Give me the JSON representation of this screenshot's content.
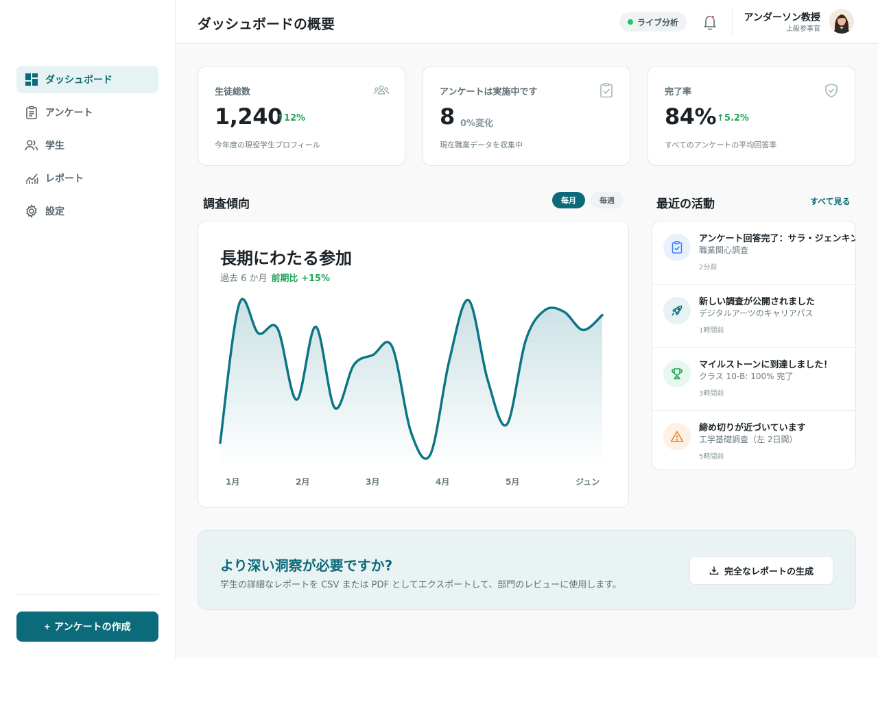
{
  "sidebar": {
    "items": [
      {
        "label": "ダッシュボード",
        "icon": "dashboard-icon",
        "active": true
      },
      {
        "label": "アンケート",
        "icon": "clipboard-icon",
        "active": false
      },
      {
        "label": "学生",
        "icon": "users-icon",
        "active": false
      },
      {
        "label": "レポート",
        "icon": "analytics-icon",
        "active": false
      },
      {
        "label": "設定",
        "icon": "gear-icon",
        "active": false
      }
    ],
    "create_button": "アンケートの作成"
  },
  "header": {
    "title": "ダッシュボードの概要",
    "live_label": "ライブ分析",
    "user_name": "アンダーソン教授",
    "user_role": "上級参事官"
  },
  "kpis": [
    {
      "label": "生徒総数",
      "value": "1,240",
      "change": "12%",
      "change_direction": "up",
      "subtitle": "今年度の現役学生プロフィール",
      "icon": "group-icon"
    },
    {
      "label": "アンケートは実施中です",
      "value": "8",
      "change": "0%変化",
      "change_direction": "none",
      "subtitle": "現在職業データを収集中",
      "icon": "checked-clipboard-icon"
    },
    {
      "label": "完了率",
      "value": "84%",
      "change": "5.2%",
      "change_direction": "up",
      "subtitle": "すべてのアンケートの平均回答率",
      "icon": "shield-check-icon"
    }
  ],
  "trends": {
    "section_title": "調査傾向",
    "toggle_monthly": "毎月",
    "toggle_weekly": "毎週",
    "selected": "monthly"
  },
  "chart_data": {
    "type": "area",
    "title": "長期にわたる参加",
    "subtitle": "過去 6 か月",
    "growth_label": "前期比 +15%",
    "x_ticks": [
      "1月",
      "2月",
      "3月",
      "4月",
      "5月",
      "ジュン"
    ],
    "x": [
      0,
      0.25,
      0.5,
      0.75,
      1,
      1.25,
      1.5,
      1.75,
      2,
      2.25,
      2.5,
      2.75,
      3,
      3.25,
      3.5,
      3.75,
      4,
      4.25,
      4.5,
      4.75,
      5
    ],
    "values": [
      0.12,
      0.96,
      0.78,
      0.81,
      0.38,
      0.82,
      0.33,
      0.59,
      0.65,
      0.7,
      0.18,
      0.05,
      0.62,
      0.98,
      0.5,
      0.23,
      0.74,
      0.92,
      0.91,
      0.8,
      0.89
    ],
    "ylim": [
      0,
      1
    ],
    "color": "#0c7584"
  },
  "activity": {
    "section_title": "最近の活動",
    "view_all": "すべて見る",
    "items": [
      {
        "title": "アンケート回答完了：サラ・ジェンキンス",
        "subtitle": "職業関心調査",
        "time": "2分前",
        "icon": "checked-clipboard-icon",
        "color": "#3b82f6"
      },
      {
        "title": "新しい調査が公開されました",
        "subtitle": "デジタルアーツのキャリアパス",
        "time": "1時間前",
        "icon": "rocket-icon",
        "color": "#0c6b7a"
      },
      {
        "title": "マイルストーンに到達しました！",
        "subtitle": "クラス 10-B: 100% 完了",
        "time": "3時間前",
        "icon": "trophy-icon",
        "color": "#22a35a"
      },
      {
        "title": "締め切りが近づいています",
        "subtitle": "工学基礎調査（左 2日間）",
        "time": "5時間前",
        "icon": "warning-icon",
        "color": "#e8822a"
      }
    ]
  },
  "cta": {
    "title": "より深い洞察が必要ですか?",
    "subtitle": "学生の詳細なレポートを CSV または PDF としてエクスポートして、部門のレビューに使用します。",
    "button": "完全なレポートの生成"
  }
}
